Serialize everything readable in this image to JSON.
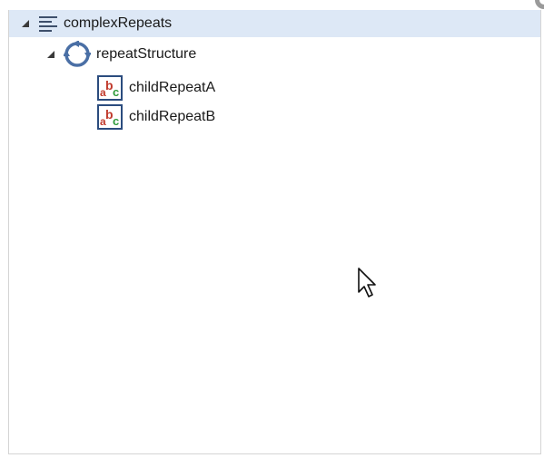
{
  "tree": {
    "root": {
      "label": "complexRepeats",
      "icon": "document-lines-icon",
      "expanded": true,
      "selected": true
    },
    "repeat": {
      "label": "repeatStructure",
      "icon": "repeat-cycle-icon",
      "expanded": true
    },
    "children": [
      {
        "label": "childRepeatA",
        "icon": "text-field-abc-icon"
      },
      {
        "label": "childRepeatB",
        "icon": "text-field-abc-icon"
      }
    ]
  },
  "colors": {
    "selection_background": "#dde8f6",
    "panel_border": "#d4d4d4",
    "repeat_icon": "#4a6fa5",
    "text_icon_border": "#2b4c7e"
  }
}
